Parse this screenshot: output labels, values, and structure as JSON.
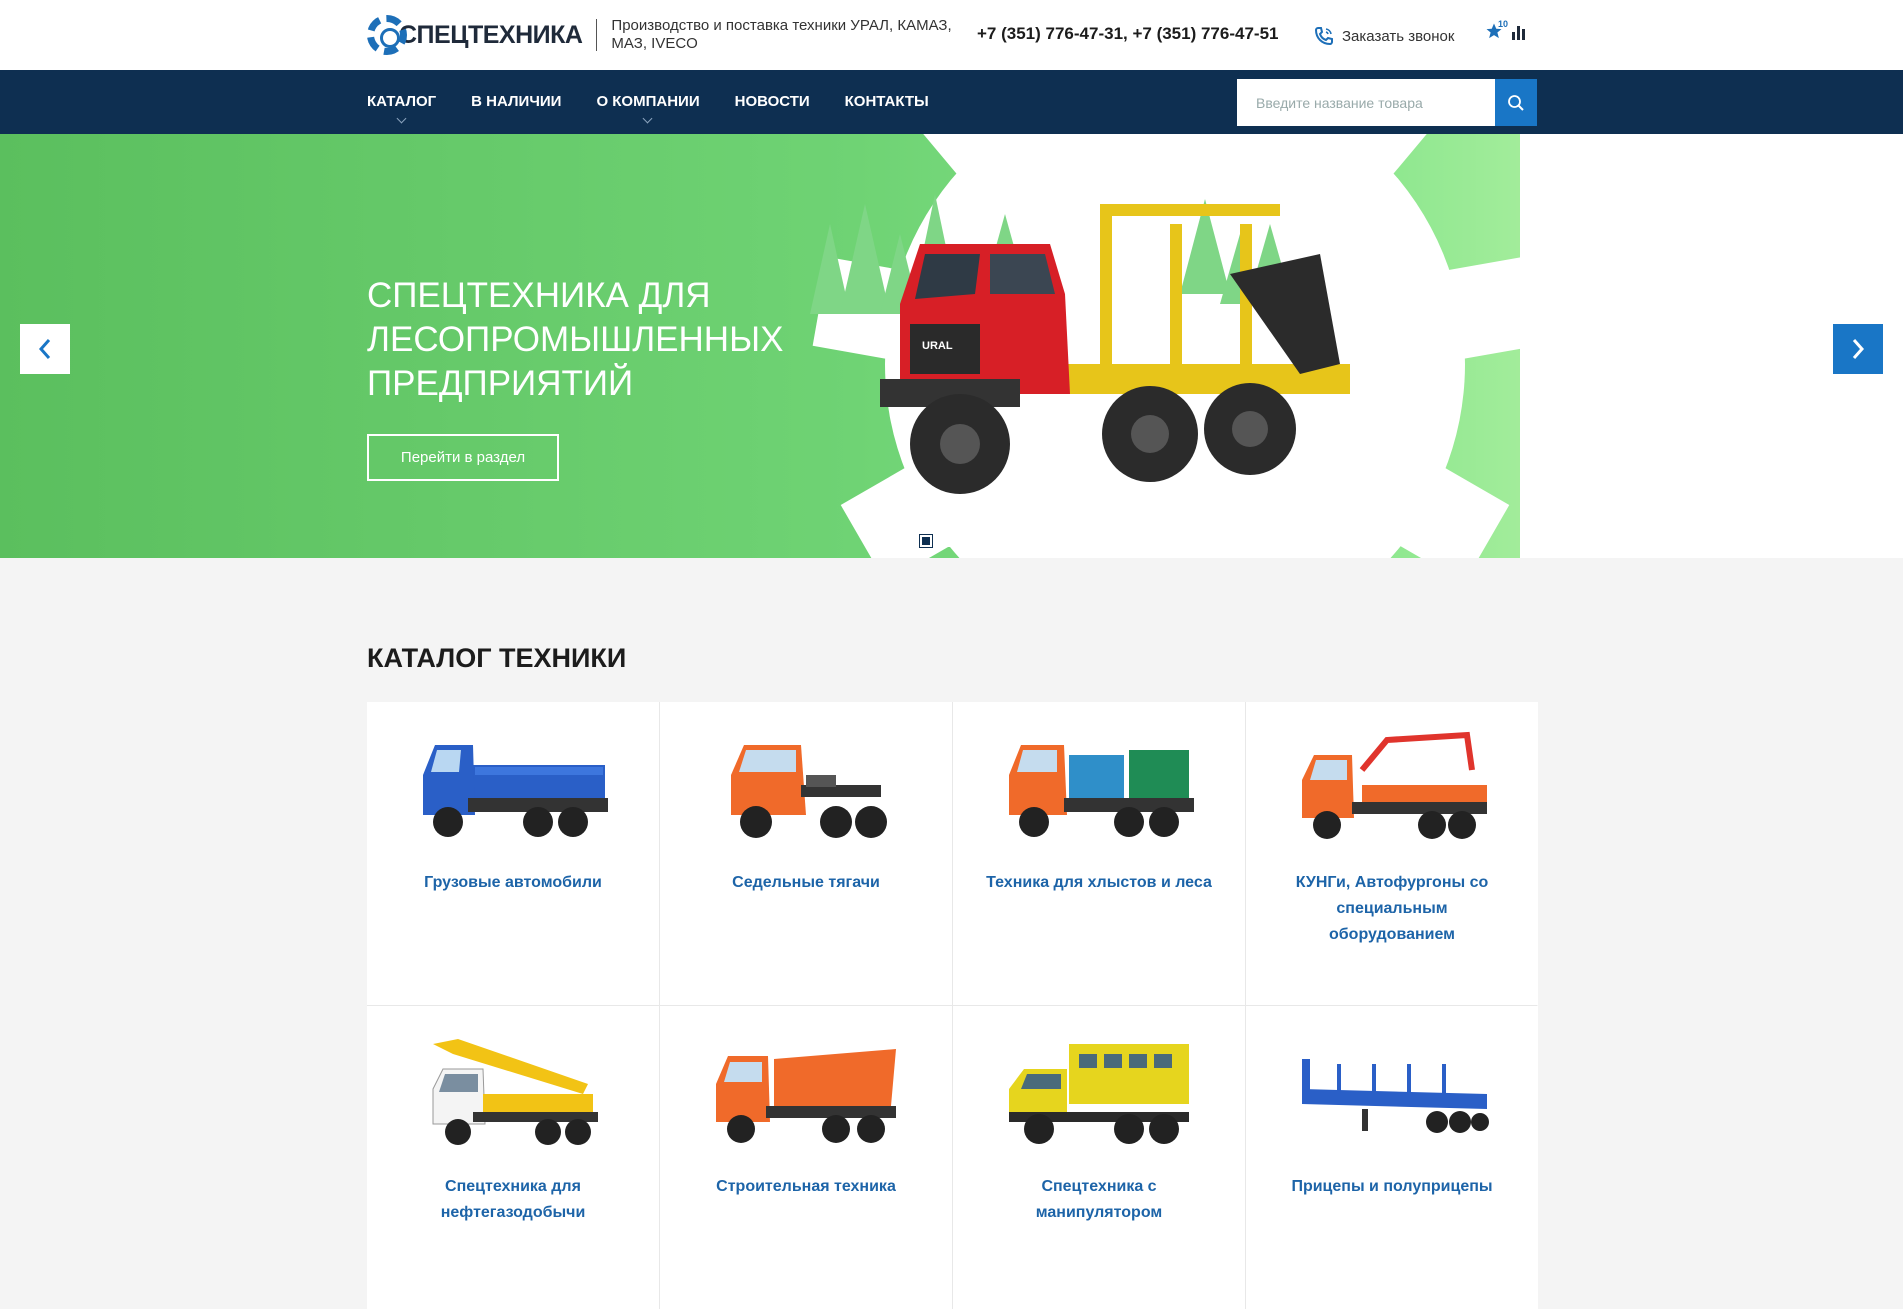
{
  "header": {
    "logo_text": "СПЕЦТЕХНИКА",
    "tagline": "Производство и поставка техники УРАЛ, КАМАЗ, МАЗ, IVECO",
    "phones": "+7 (351) 776-47-31, +7 (351) 776-47-51",
    "callback_label": "Заказать звонок",
    "favorites_count": "10",
    "icons": [
      "phone-icon",
      "star-icon",
      "compare-icon"
    ]
  },
  "nav": {
    "items": [
      {
        "label": "КАТАЛОГ",
        "has_dropdown": true
      },
      {
        "label": "В НАЛИЧИИ",
        "has_dropdown": false
      },
      {
        "label": "О КОМПАНИИ",
        "has_dropdown": true
      },
      {
        "label": "НОВОСТИ",
        "has_dropdown": false
      },
      {
        "label": "КОНТАКТЫ",
        "has_dropdown": false
      }
    ],
    "search_placeholder": "Введите название товара"
  },
  "hero": {
    "title": "СПЕЦТЕХНИКА ДЛЯ ЛЕСОПРОМЫШЛЕННЫХ ПРЕДПРИЯТИЙ",
    "button_label": "Перейти в раздел",
    "slides_total": 3,
    "active_slide": 1
  },
  "catalog": {
    "title": "КАТАЛОГ ТЕХНИКИ",
    "items": [
      {
        "label": "Грузовые автомобили",
        "icon": "flatbed-truck-icon",
        "color": "#2a5fc7"
      },
      {
        "label": "Седельные тягачи",
        "icon": "tractor-unit-icon",
        "color": "#f06a2a"
      },
      {
        "label": "Техника для хлыстов и леса",
        "icon": "timber-truck-icon",
        "color": "#f06a2a"
      },
      {
        "label": "КУНГи, Автофургоны со специальным оборудованием",
        "icon": "crane-manipulator-truck-icon",
        "color": "#f06a2a"
      },
      {
        "label": "Спецтехника для нефтегазодобычи",
        "icon": "mobile-crane-icon",
        "color": "#f2c315"
      },
      {
        "label": "Строительная техника",
        "icon": "dump-truck-icon",
        "color": "#f06a2a"
      },
      {
        "label": "Спецтехника с манипулятором",
        "icon": "crew-bus-truck-icon",
        "color": "#e6d51e"
      },
      {
        "label": "Прицепы и полуприцепы",
        "icon": "semitrailer-icon",
        "color": "#2a5fc7"
      }
    ]
  },
  "colors": {
    "nav_bg": "#0e2f51",
    "accent": "#1976c6",
    "link": "#1d64a8",
    "hero_green": "#6fd374"
  }
}
